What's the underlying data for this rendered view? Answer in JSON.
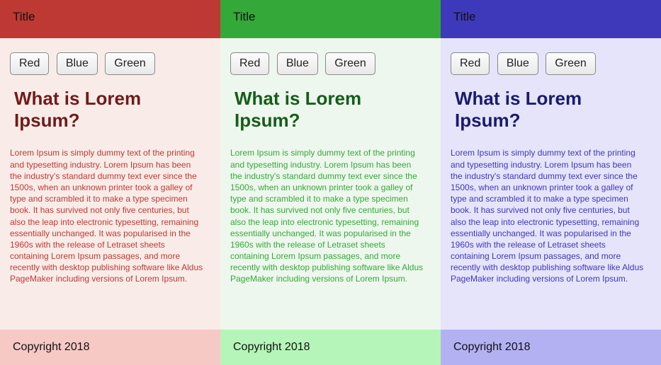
{
  "columns": [
    {
      "theme": "red",
      "header_title": "Title",
      "footer_text": "Copyright 2018"
    },
    {
      "theme": "green",
      "header_title": "Title",
      "footer_text": "Copyright 2018"
    },
    {
      "theme": "blue",
      "header_title": "Title",
      "footer_text": "Copyright 2018"
    }
  ],
  "buttons": {
    "red": "Red",
    "blue": "Blue",
    "green": "Green"
  },
  "article": {
    "heading": "What is Lorem Ipsum?",
    "body": "Lorem Ipsum is simply dummy text of the printing and typesetting industry. Lorem Ipsum has been the industry's standard dummy text ever since the 1500s, when an unknown printer took a galley of type and scrambled it to make a type specimen book. It has survived not only five centuries, but also the leap into electronic typesetting, remaining essentially unchanged. It was popularised in the 1960s with the release of Letraset sheets containing Lorem Ipsum passages, and more recently with desktop publishing software like Aldus PageMaker including versions of Lorem Ipsum."
  }
}
